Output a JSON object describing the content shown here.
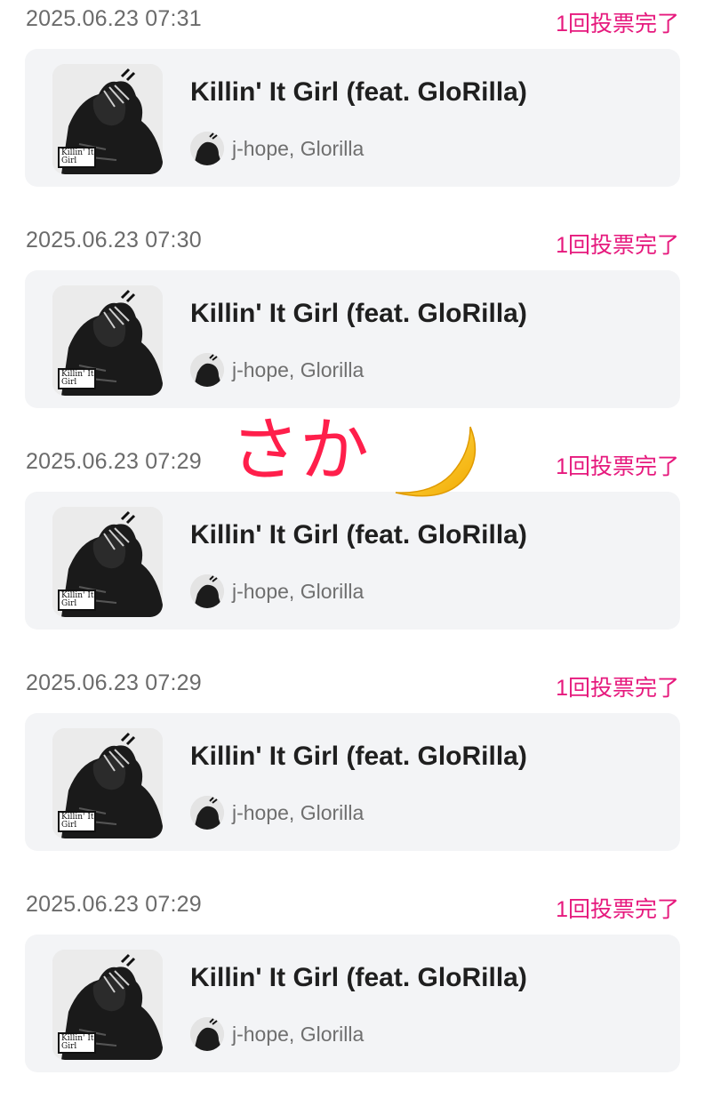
{
  "entries": [
    {
      "timestamp": "2025.06.23 07:31",
      "status": "1回投票完了",
      "song_title": "Killin' It Girl (feat. GloRilla)",
      "artist": "j-hope, Glorilla",
      "cover_text": "Killin' It\nGirl"
    },
    {
      "timestamp": "2025.06.23 07:30",
      "status": "1回投票完了",
      "song_title": "Killin' It Girl (feat. GloRilla)",
      "artist": "j-hope, Glorilla",
      "cover_text": "Killin' It\nGirl"
    },
    {
      "timestamp": "2025.06.23 07:29",
      "status": "1回投票完了",
      "song_title": "Killin' It Girl (feat. GloRilla)",
      "artist": "j-hope, Glorilla",
      "cover_text": "Killin' It\nGirl"
    },
    {
      "timestamp": "2025.06.23 07:29",
      "status": "1回投票完了",
      "song_title": "Killin' It Girl (feat. GloRilla)",
      "artist": "j-hope, Glorilla",
      "cover_text": "Killin' It\nGirl"
    },
    {
      "timestamp": "2025.06.23 07:29",
      "status": "1回投票完了",
      "song_title": "Killin' It Girl (feat. GloRilla)",
      "artist": "j-hope, Glorilla",
      "cover_text": "Killin' It\nGirl"
    }
  ],
  "overlay": {
    "handwritten_text": "さか",
    "emoji_icon": "crescent-moon-icon"
  },
  "colors": {
    "status": "#e6197d",
    "timestamp": "#6b6b6b",
    "card_background": "#f3f4f6",
    "overlay_text": "#ff1f4b",
    "moon": "#f7c623"
  }
}
